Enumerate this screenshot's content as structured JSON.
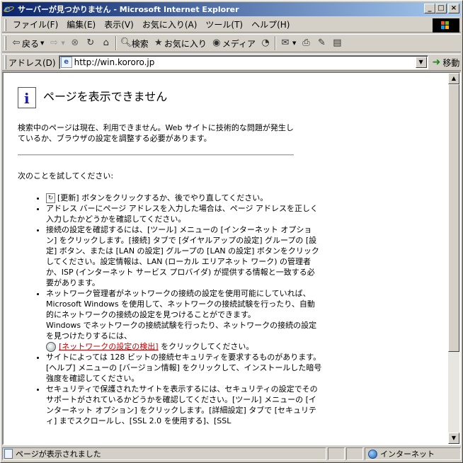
{
  "window": {
    "title": "サーバーが見つかりません - Microsoft Internet Explorer",
    "minimize": "_",
    "maximize": "□",
    "close": "×"
  },
  "menu": {
    "items": [
      "ファイル(F)",
      "編集(E)",
      "表示(V)",
      "お気に入り(A)",
      "ツール(T)",
      "ヘルプ(H)"
    ]
  },
  "toolbar": {
    "back": "戻る",
    "search": "検索",
    "favorites": "お気に入り",
    "media": "メディア"
  },
  "address": {
    "label": "アドレス(D)",
    "url": "http://win.kororo.jp",
    "go": "移動"
  },
  "page": {
    "title": "ページを表示できません",
    "description": "検索中のページは現在、利用できません。Web サイトに技術的な問題が発生しているか、ブラウザの設定を調整する必要があります。",
    "try_label": "次のことを試してください:",
    "tip1_label": "[更新]",
    "tip1": "ボタンをクリックするか、後でやり直してください。",
    "tip2": "アドレス バーにページ アドレスを入力した場合は、ページ アドレスを正しく入力したかどうかを確認してください。",
    "tip3": "接続の設定を確認するには、[ツール] メニューの [インターネット オプション] をクリックします。[接続] タブで [ダイヤルアップの設定] グループの [設定] ボタン、または [LAN の設定] グループの [LAN の設定] ボタンをクリックしてください。設定情報は、LAN (ローカル エリアネット ワーク) の管理者か、ISP (インターネット サービス プロバイダ) が提供する情報と一致する必要があります。",
    "tip4": "ネットワーク管理者がネットワークの接続の設定を使用可能にしていれば、Microsoft Windows を使用して、ネットワークの接続試験を行ったり、自動的にネットワークの接続の設定を見つけることができます。",
    "tip4b": "Windows でネットワークの接続試験を行ったり、ネットワークの接続の設定を見つけたりするには、",
    "tip4_link": "[ネットワークの設定の検出]",
    "tip4_after": "をクリックしてください。",
    "tip5": "サイトによっては 128 ビットの接続セキュリティを要求するものがあります。[ヘルプ] メニューの [バージョン情報] をクリックして、インストールした暗号強度を確認してください。",
    "tip6": "セキュリティで保護されたサイトを表示するには、セキュリティの設定でそのサポートがされているかどうかを確認してください。[ツール] メニューの [インターネット オプション] をクリックします。[詳細設定] タブで [セキュリティ] までスクロールし、[SSL 2.0 を使用する]、[SSL"
  },
  "status": {
    "text": "ページが表示されました",
    "zone": "インターネット"
  }
}
